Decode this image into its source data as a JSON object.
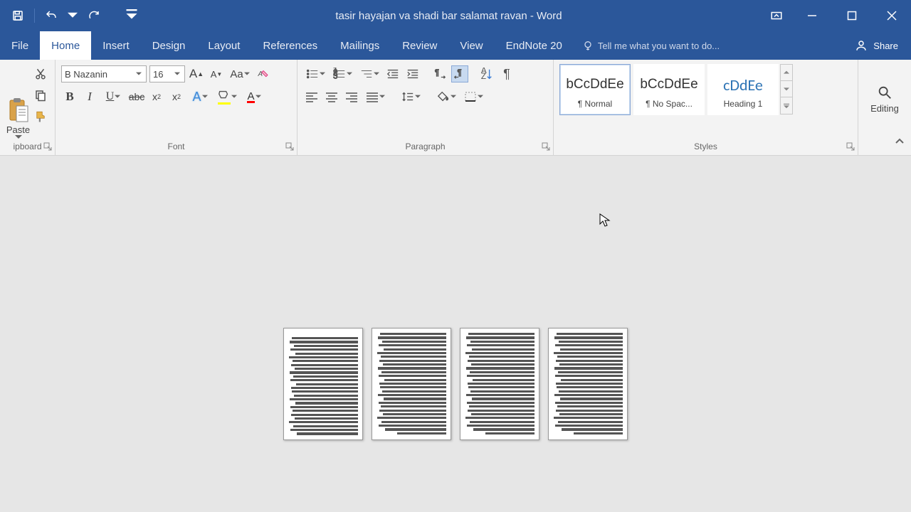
{
  "title": "tasir hayajan va shadi bar salamat ravan - Word",
  "tabs": {
    "file": "File",
    "home": "Home",
    "insert": "Insert",
    "design": "Design",
    "layout": "Layout",
    "references": "References",
    "mailings": "Mailings",
    "review": "Review",
    "view": "View",
    "endnote": "EndNote 20"
  },
  "tell": "Tell me what you want to do...",
  "share": "Share",
  "clipboard": {
    "paste": "Paste",
    "label": "ipboard"
  },
  "font": {
    "name": "B Nazanin",
    "size": "16",
    "label": "Font"
  },
  "paragraph": {
    "label": "Paragraph"
  },
  "styles": {
    "label": "Styles",
    "items": [
      {
        "sample": "bCcDdEe",
        "name": "¶ Normal"
      },
      {
        "sample": "bCcDdEe",
        "name": "¶ No Spac..."
      },
      {
        "sample": "cDdEe",
        "name": "Heading 1"
      }
    ]
  },
  "editing": {
    "label": "Editing"
  }
}
